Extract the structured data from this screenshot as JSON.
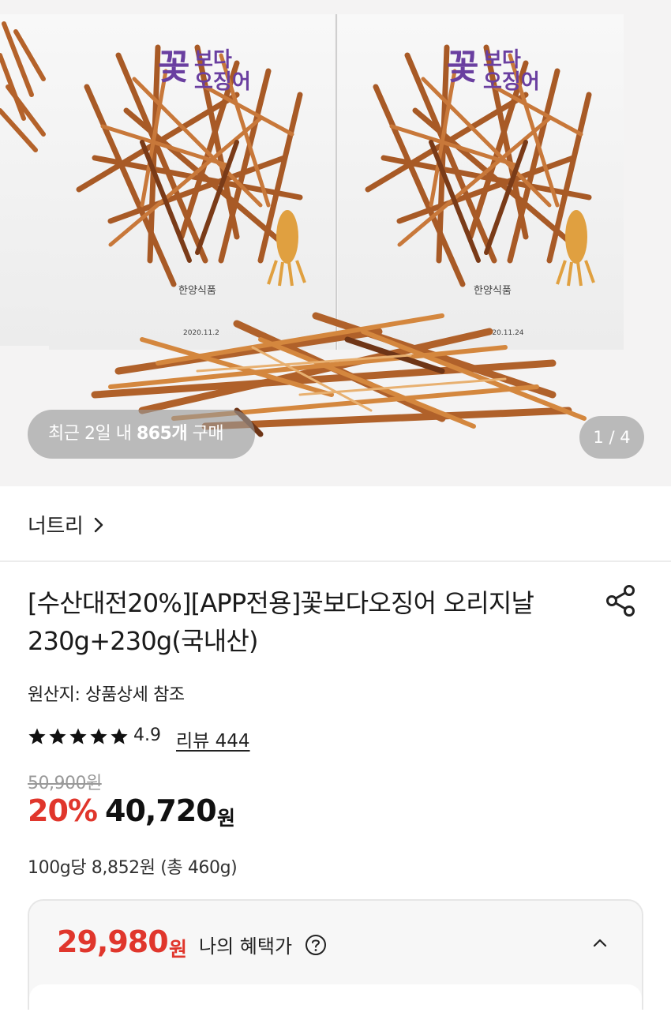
{
  "gallery": {
    "product_image": "dried-squid-package-photo",
    "package_brand_text": "꽃보다오징어",
    "package_maker_text": "한양식품",
    "purchase_badge": {
      "prefix": "최근 2일 내 ",
      "count": "865개",
      "suffix": " 구매"
    },
    "page_indicator": "1 / 4"
  },
  "store": {
    "name": "너트리",
    "chevron_icon": "chevron-right-icon"
  },
  "product": {
    "title": "[수산대전20%][APP전용]꽃보다오징어 오리지날 230g+230g(국내산)",
    "share_icon": "share-icon",
    "origin": "원산지: 상품상세 참조",
    "rating": 4.9,
    "rating_text": "4.9",
    "stars_filled": 5,
    "review_label": "리뷰 444",
    "original_price": "50,900원",
    "discount": "20%",
    "sale_price": "40,720",
    "sale_currency": "원",
    "unit_price": "100g당 8,852원 (총 460g)"
  },
  "benefit": {
    "price": "29,980",
    "currency": "원",
    "label": "나의 혜택가",
    "help_icon": "question-circle-icon",
    "toggle_icon": "chevron-up-icon"
  },
  "colors": {
    "accent_red": "#e0362c",
    "text": "#111111",
    "muted": "#999999",
    "gallery_bg": "#f4f3f3"
  }
}
